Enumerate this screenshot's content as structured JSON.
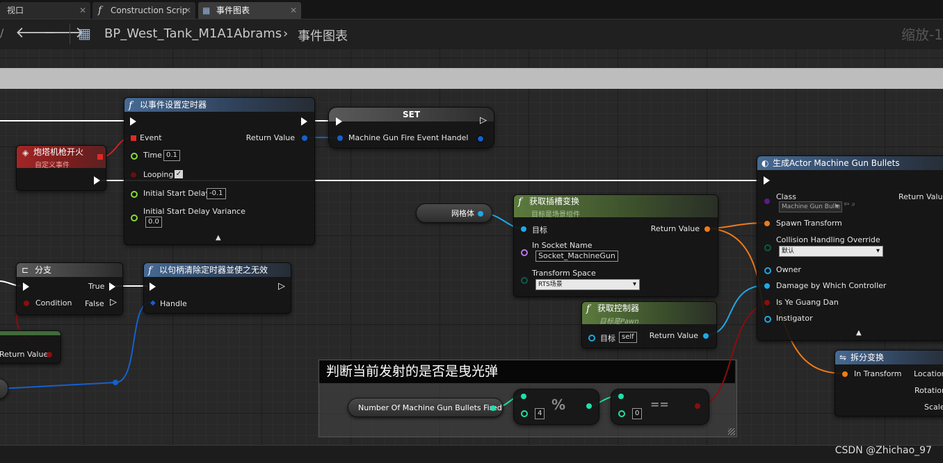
{
  "tabs": [
    {
      "label": "视口"
    },
    {
      "label": "Construction Scrip"
    },
    {
      "label": "事件图表"
    }
  ],
  "toolbar": {
    "blueprint_name": "BP_West_Tank_M1A1Abrams",
    "separator": "›",
    "graph_name": "事件图表",
    "zoom_label": "缩放-1"
  },
  "nodes": {
    "set_timer": {
      "title": "以事件设置定时器",
      "event": "Event",
      "return_value": "Return Value",
      "time_label": "Time",
      "time_value": "0.1",
      "looping_label": "Looping",
      "looping_checked": true,
      "initial_delay_label": "Initial Start Delay",
      "initial_delay_value": "-0.1",
      "variance_label": "Initial Start Delay Variance",
      "variance_value": "0.0"
    },
    "set_var": {
      "title": "SET",
      "var_label": "Machine Gun Fire Event Handel"
    },
    "custom_event": {
      "title": "炮塔机枪开火",
      "subtitle": "自定义事件"
    },
    "branch": {
      "title": "分支",
      "true_label": "True",
      "false_label": "False",
      "condition_label": "Condition"
    },
    "clear_timer": {
      "title": "以句柄清除定时器並使之无效",
      "handle_label": "Handle"
    },
    "partial_node": {
      "return_label": "Return Value"
    },
    "mesh_var": {
      "label": "网格体"
    },
    "socket_transform": {
      "title": "获取插槽变换",
      "subtitle": "目标是场景组件",
      "target_label": "目标",
      "return_value": "Return Value",
      "socket_name_label": "In Socket Name",
      "socket_name_value": "Socket_MachineGun",
      "space_label": "Transform Space",
      "space_value": "RTS场景"
    },
    "get_controller": {
      "title": "获取控制器",
      "subtitle": "目标是Pawn",
      "target_label": "目标",
      "target_value": "self",
      "return_value": "Return Value"
    },
    "spawn_actor": {
      "title": "生成Actor Machine Gun Bullets",
      "class_label": "Class",
      "class_value": "Machine Gun Bulle",
      "return_value": "Return Value",
      "spawn_transform": "Spawn Transform",
      "collision_label": "Collision Handling Override",
      "collision_value": "默认",
      "owner": "Owner",
      "damage": "Damage by Which Controller",
      "tracer": "Is Ye Guang Dan",
      "instigator": "Instigator"
    },
    "break_transform": {
      "title": "拆分变换",
      "in_transform": "In Transform",
      "location": "Location",
      "rotation": "Rotation",
      "scale": "Scale"
    },
    "bullets_var": {
      "label": "Number Of Machine Gun Bullets Fired"
    },
    "modulo": {
      "symbol": "%",
      "value": "4"
    },
    "equals": {
      "symbol": "==",
      "value": "0"
    }
  },
  "comment": {
    "title": "判断当前发射的是否是曳光弹"
  },
  "watermark": "CSDN @Zhichao_97",
  "colors": {
    "exec": "#ffffff",
    "object_pin": "#1fa8e8",
    "transform_pin": "#f07a18",
    "bool_pin": "#9b0e0e",
    "int_pin": "#1fe0a8",
    "delegate_pin": "#e22828",
    "timer_handle_pin": "#1560d0",
    "name_pin": "#b878e8"
  }
}
